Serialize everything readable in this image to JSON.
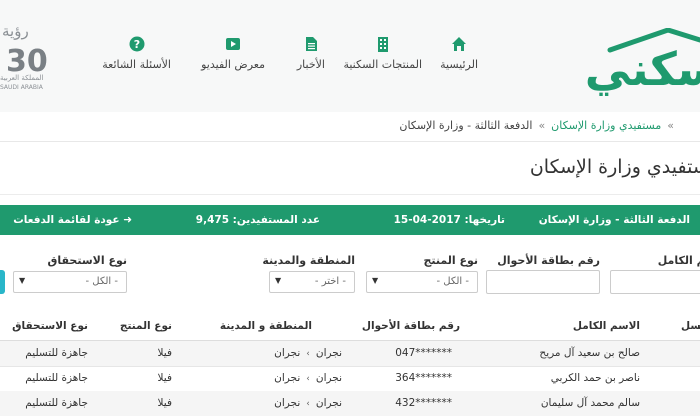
{
  "header": {
    "logo_text": "سكني",
    "vision": {
      "ar": "رؤية",
      "num": "30",
      "sub1": "المملكة العربية",
      "sub2": "SAUDI ARABIA"
    },
    "nav": [
      {
        "label": "الرئيسية",
        "icon": "home-icon"
      },
      {
        "label": "المنتجات السكنية",
        "icon": "building-icon"
      },
      {
        "label": "الأخبار",
        "icon": "document-icon"
      },
      {
        "label": "معرض الفيديو",
        "icon": "play-icon"
      },
      {
        "label": "الأسئلة الشائعة",
        "icon": "question-icon"
      }
    ],
    "colors": {
      "brand": "#1f9a6e",
      "nav_icon": "#1f9a6e"
    }
  },
  "breadcrumb": {
    "items": [
      "مستفيدي وزارة الإسكان",
      "الدفعة الثالثة - وزارة الإسكان"
    ],
    "separator": "»"
  },
  "page_title": "مستفيدي وزارة الإسكان",
  "info_bar": {
    "batch": "الدفعة الثالثة - وزارة الإسكان",
    "date": "تاريخها: 2017-04-15",
    "count": "عدد المستفيدين: 9,475",
    "back": "➜ عودة لقائمة الدفعات"
  },
  "filters": {
    "name_label": "الاسم الكامل",
    "id_label": "رقم بطاقة الأحوال",
    "product_label": "نوع المنتج",
    "product_value": "- الكل -",
    "region_label": "المنطقة والمدينة",
    "region_value": "- اختر -",
    "eligibility_label": "نوع الاستحقاق",
    "eligibility_value": "- الكل -"
  },
  "table": {
    "headers": {
      "seq": "تسلسل",
      "name": "الاسم الكامل",
      "id": "رقم بطاقة الأحوال",
      "region": "المنطقة و المدينة",
      "product": "نوع المنتج",
      "eligibility": "نوع الاستحقاق"
    },
    "rows": [
      {
        "name": "صالح بن سعيد آل مريح",
        "id": "047*******",
        "region": "نجران",
        "city": "نجران",
        "product": "فيلا",
        "eligibility": "جاهزة للتسليم"
      },
      {
        "name": "ناصر بن حمد الكربي",
        "id": "364*******",
        "region": "نجران",
        "city": "نجران",
        "product": "فيلا",
        "eligibility": "جاهزة للتسليم"
      },
      {
        "name": "سالم محمد آل سليمان",
        "id": "432*******",
        "region": "نجران",
        "city": "نجران",
        "product": "فيلا",
        "eligibility": "جاهزة للتسليم"
      }
    ]
  }
}
